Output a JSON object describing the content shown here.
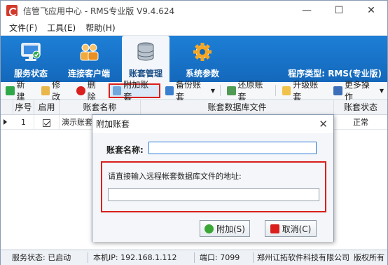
{
  "window": {
    "title": "信管飞应用中心 - RMS专业版 V9.4.624",
    "minimize_glyph": "—",
    "maximize_glyph": "☐",
    "close_glyph": "✕"
  },
  "menu": [
    "文件(F)",
    "工具(E)",
    "帮助(H)"
  ],
  "ribbon": {
    "tabs": [
      {
        "label": "服务状态",
        "icon": "monitor-icon"
      },
      {
        "label": "连接客户端",
        "icon": "users-icon"
      },
      {
        "label": "账套管理",
        "icon": "database-icon",
        "active": true
      },
      {
        "label": "系统参数",
        "icon": "gear-icon"
      }
    ],
    "program_type": "程序类型: RMS(专业版)"
  },
  "toolbar": {
    "new": "新建",
    "edit": "修改",
    "delete": "删除",
    "attach": "附加账套",
    "backup": "备份账套",
    "restore": "还原账套",
    "upgrade": "升级账套",
    "more": "更多操作"
  },
  "grid": {
    "headers": [
      "序号",
      "启用",
      "账套名称",
      "账套数据库文件",
      "账套状态"
    ],
    "rows": [
      {
        "index": "1",
        "enabled": true,
        "name": "演示账套",
        "file": "",
        "status": "正常"
      }
    ]
  },
  "statusbar": {
    "service": "服务状态: 已启动",
    "ip": "本机IP: 192.168.1.112",
    "port": "端口: 7099",
    "company": "郑州讧拓软件科技有限公司",
    "copyright": "版权所有"
  },
  "dialog": {
    "title": "附加账套",
    "close": "✕",
    "account_name_label": "账套名称:",
    "account_name_value": "",
    "remote_label": "请直接输入远程帐套数据库文件的地址:",
    "remote_value": "",
    "ok_label": "附加(S)",
    "cancel_label": "取消(C)"
  },
  "colors": {
    "ribbon": "#1468bb",
    "highlight_border": "#d9201c",
    "ok_icon": "#3aa635",
    "cancel_icon": "#d9201c"
  }
}
